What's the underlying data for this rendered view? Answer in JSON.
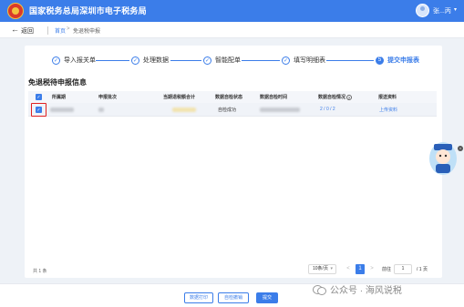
{
  "header": {
    "site_title": "国家税务总局深圳市电子税务局",
    "user_name": "张...丙",
    "emblem_icon": "tax-emblem-icon",
    "brand_color": "#3b7de9"
  },
  "subbar": {
    "back_label": "返回",
    "breadcrumb_home": "首页",
    "breadcrumb_sep": ">",
    "breadcrumb_current": "免退税申报"
  },
  "steps": [
    {
      "number": "1",
      "label": "导入报关单",
      "state": "done"
    },
    {
      "number": "2",
      "label": "处理数据",
      "state": "done"
    },
    {
      "number": "3",
      "label": "智能配单",
      "state": "done"
    },
    {
      "number": "4",
      "label": "填写明细表",
      "state": "done"
    },
    {
      "number": "5",
      "label": "提交申报表",
      "state": "active"
    }
  ],
  "section_title": "免退税待申报信息",
  "table": {
    "columns": [
      "所属期",
      "申报批次",
      "当期退税额合计",
      "数据自检状态",
      "数据自检时间",
      "数据自检情况",
      "报送资料"
    ],
    "rows": [
      {
        "checked": true,
        "period": "",
        "batch": "",
        "refund_total": "",
        "check_status": "自检成功",
        "check_time": "",
        "check_summary": "2 / 0 / 2",
        "docs_link": "上传资料"
      }
    ]
  },
  "pagination": {
    "total_text": "共 1 条",
    "page_size": "10条/页",
    "prev": "<",
    "current_page": "1",
    "next": ">",
    "goto_label": "前往",
    "goto_value": "1",
    "total_pages": "/ 1 页"
  },
  "footer": {
    "btn_print": "数据打印",
    "btn_withdraw": "自检撤销",
    "btn_submit": "提交"
  },
  "watermark": "公众号 · 海风说税",
  "mascot": {
    "icon": "assistant-mascot-icon",
    "close": "×"
  }
}
